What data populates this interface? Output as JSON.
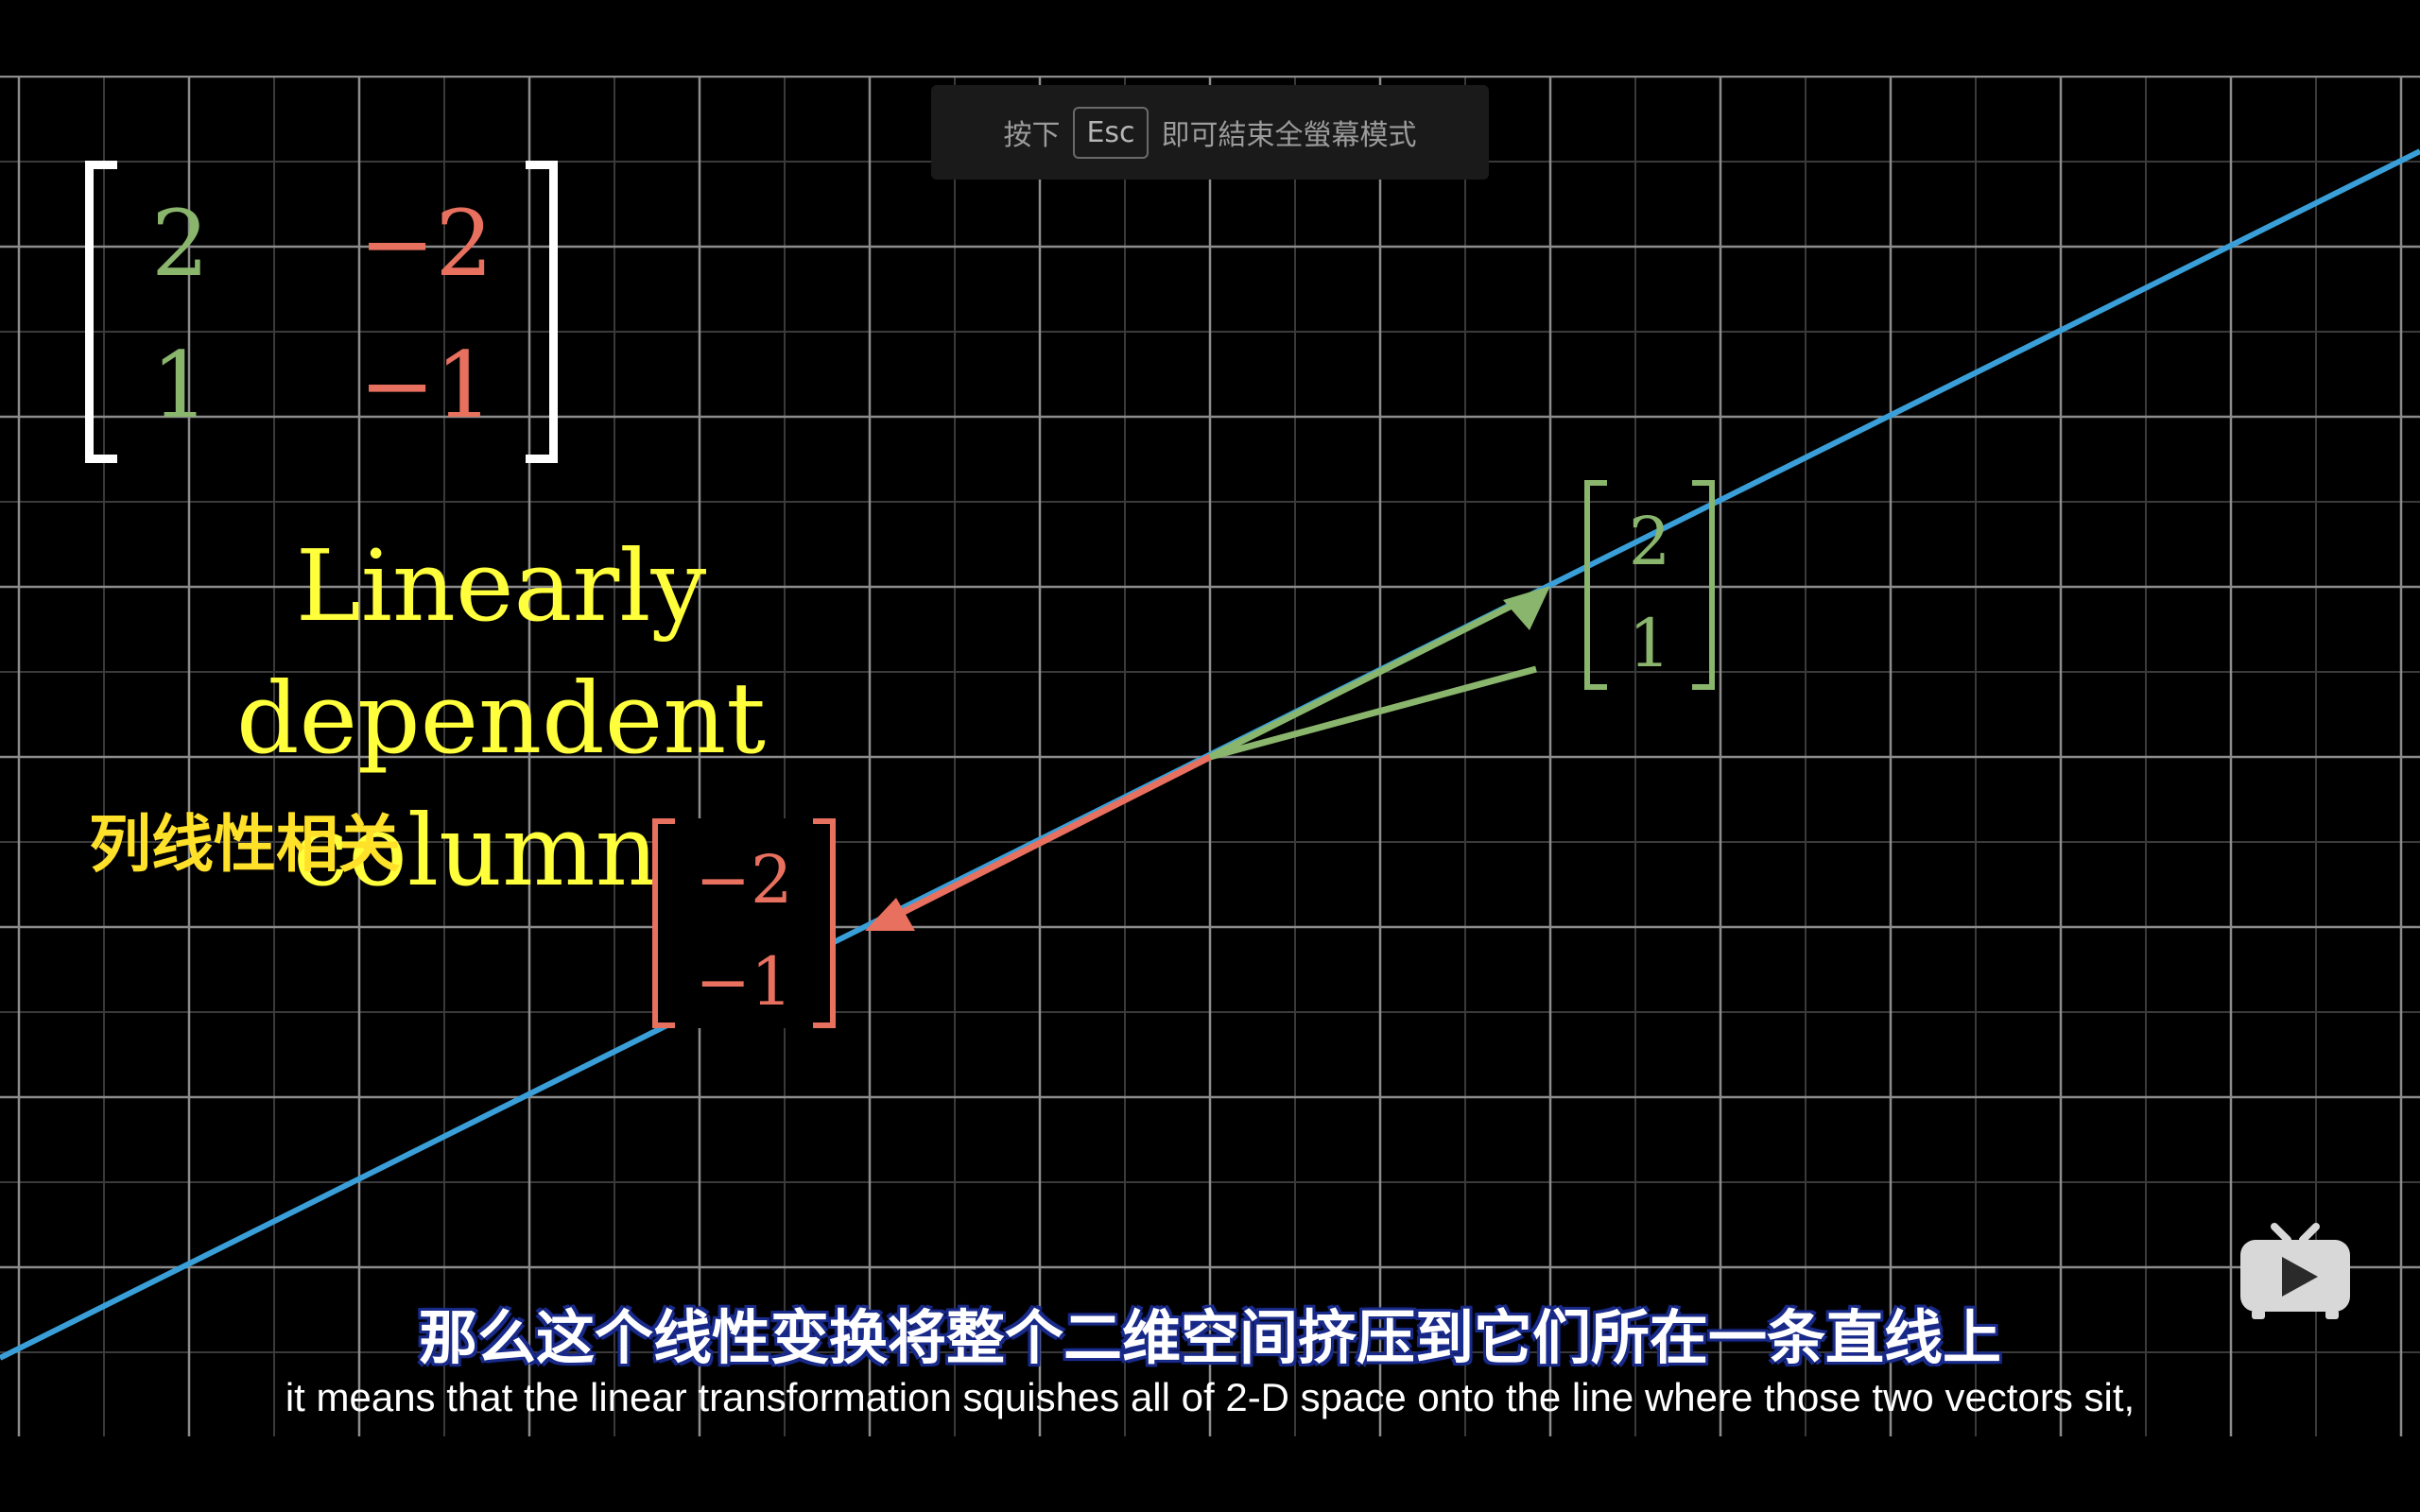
{
  "fullscreen_hint": {
    "prefix": "按下",
    "key": "Esc",
    "suffix": "即可結束全螢幕模式"
  },
  "matrix": {
    "a11": "2",
    "a12": "−2",
    "a21": "1",
    "a22": "−1"
  },
  "title_line1": "Linearly dependent",
  "title_line2": "columns",
  "cn_label": "列线性相关",
  "vector_green": {
    "top": "2",
    "bottom": "1"
  },
  "vector_red": {
    "top": "−2",
    "bottom": "−1"
  },
  "subtitle_cn": "那么这个线性变换将整个二维空间挤压到它们所在一条直线上",
  "subtitle_en": "it means that the linear transformation squishes all of 2-D space onto the line where those two vectors sit,",
  "colors": {
    "line": "#3a9fd8",
    "green": "#8ab56d",
    "red": "#e8705f",
    "title": "#ffff3c",
    "cn_label": "#ffe12a",
    "grid": "#8c8c8c"
  },
  "icons": {
    "player": "bilibili-tv-icon"
  }
}
